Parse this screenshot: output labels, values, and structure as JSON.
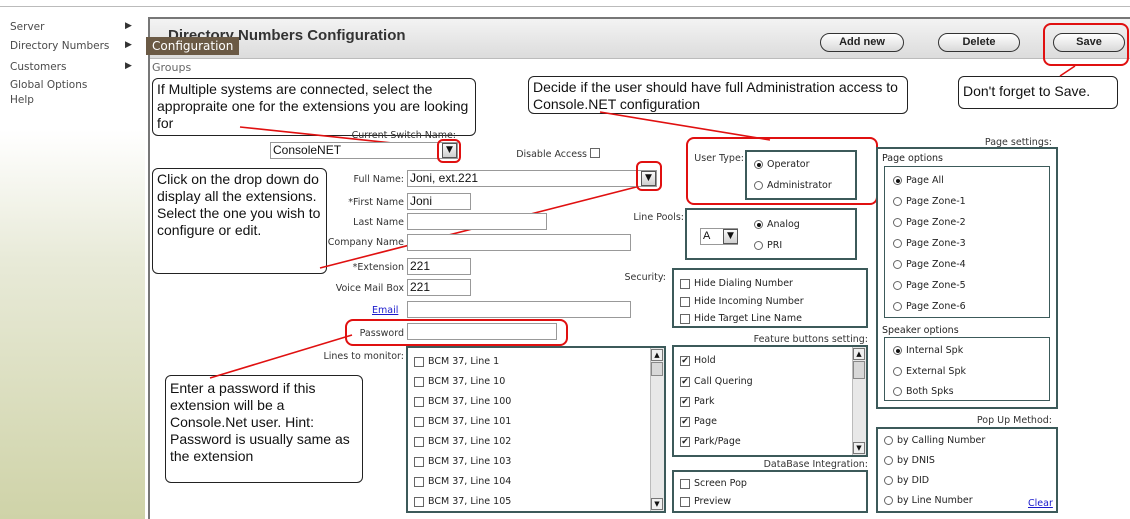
{
  "sidebar": {
    "items": [
      {
        "label": "Server",
        "has_arrow": true
      },
      {
        "label": "Directory Numbers",
        "has_arrow": true
      },
      {
        "label": "Customers",
        "has_arrow": true
      },
      {
        "label": "Global Options",
        "has_arrow": false
      },
      {
        "label": "Help",
        "has_arrow": false
      }
    ],
    "arrow": "▶"
  },
  "header": {
    "title": "Directory Numbers Configuration",
    "submenu_active": "Configuration",
    "submenu_other": "Groups",
    "add_new": "Add new",
    "delete": "Delete",
    "save": "Save"
  },
  "callouts": {
    "multiple_systems": "If Multiple systems are connected, select the appropraite one for the extensions you are looking for",
    "admin_access": "Decide if the user should have full Administration access to Console.NET configuration",
    "save_reminder": "Don't forget to Save.",
    "dropdown_hint": "Click on the drop down do display all the extensions. Select the one you wish to configure or edit.",
    "password_hint": "Enter a password if this extension will be a Console.Net user. Hint: Password is usually same as the extension"
  },
  "form": {
    "current_switch_label": "Current Switch Name:",
    "current_switch_value": "ConsoleNET",
    "disable_access_label": "Disable Access",
    "full_name_label": "Full Name:",
    "full_name_value": "Joni, ext.221",
    "first_name_label": "*First Name",
    "first_name_value": "Joni",
    "last_name_label": "Last Name",
    "last_name_value": "",
    "company_name_label": "Company Name",
    "company_name_value": "",
    "extension_label": "*Extension",
    "extension_value": "221",
    "voicemail_label": "Voice Mail Box",
    "voicemail_value": "221",
    "email_label": "Email",
    "email_value": "",
    "password_label": "Password",
    "password_value": "",
    "lines_monitor_label": "Lines to monitor:",
    "lines": [
      "BCM 37, Line 1",
      "BCM 37, Line 10",
      "BCM 37, Line 100",
      "BCM 37, Line 101",
      "BCM 37, Line 102",
      "BCM 37, Line 103",
      "BCM 37, Line 104",
      "BCM 37, Line 105"
    ]
  },
  "user_type": {
    "label": "User Type:",
    "options": [
      "Operator",
      "Administrator"
    ],
    "selected": "Operator"
  },
  "line_pools": {
    "label": "Line Pools:",
    "select_value": "A",
    "options": [
      "Analog",
      "PRI"
    ],
    "selected": "Analog"
  },
  "security": {
    "label": "Security:",
    "options": [
      "Hide Dialing Number",
      "Hide Incoming Number",
      "Hide Target Line Name"
    ]
  },
  "feature_buttons": {
    "label": "Feature buttons setting:",
    "items": [
      {
        "label": "Hold",
        "checked": true
      },
      {
        "label": "Call Quering",
        "checked": true
      },
      {
        "label": "Park",
        "checked": true
      },
      {
        "label": "Page",
        "checked": true
      },
      {
        "label": "Park/Page",
        "checked": true
      }
    ]
  },
  "database_integration": {
    "label": "DataBase Integration:",
    "items": [
      "Screen Pop",
      "Preview"
    ]
  },
  "page_settings": {
    "label": "Page settings:",
    "page_options_label": "Page options",
    "page_options": [
      "Page All",
      "Page Zone-1",
      "Page Zone-2",
      "Page Zone-3",
      "Page Zone-4",
      "Page Zone-5",
      "Page Zone-6"
    ],
    "page_selected": "Page All",
    "speaker_options_label": "Speaker options",
    "speaker_options": [
      "Internal Spk",
      "External Spk",
      "Both Spks"
    ],
    "speaker_selected": "Internal Spk"
  },
  "popup_method": {
    "label": "Pop Up Method:",
    "options": [
      "by Calling Number",
      "by DNIS",
      "by DID",
      "by Line Number"
    ],
    "clear": "Clear"
  },
  "icons": {
    "dropdown": "▼",
    "scroll_up": "▲",
    "scroll_down": "▼",
    "check": "✔"
  },
  "colors": {
    "annotation_red": "#e01010",
    "panel_border": "#3c5a5a",
    "submenu_bg": "#6b5a45"
  }
}
